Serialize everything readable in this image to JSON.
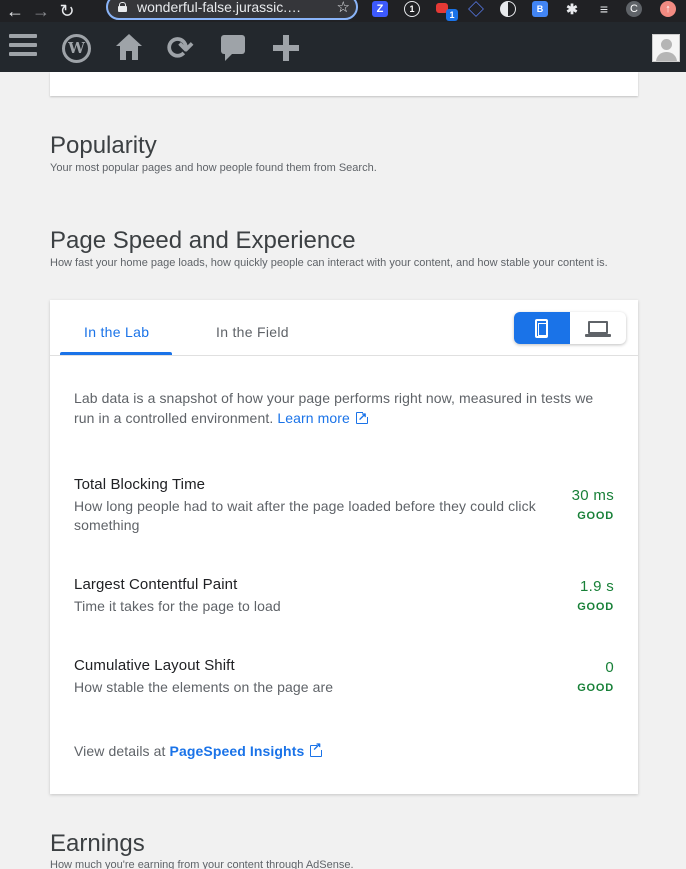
{
  "browser": {
    "url": "wonderful-false.jurassic.…",
    "extension_badge": "1",
    "profile_initial": "C"
  },
  "admin_bar": {
    "icons": [
      "menu-icon",
      "wordpress-logo",
      "home-icon",
      "refresh-icon",
      "comment-icon",
      "plus-icon",
      "avatar"
    ]
  },
  "popularity": {
    "title": "Popularity",
    "description": "Your most popular pages and how people found them from Search."
  },
  "page_speed": {
    "title": "Page Speed and Experience",
    "description": "How fast your home page loads, how quickly people can interact with your content, and how stable your content is.",
    "tabs": [
      {
        "label": "In the Lab",
        "active": true
      },
      {
        "label": "In the Field",
        "active": false
      }
    ],
    "device_toggle": {
      "selected": "mobile",
      "options": [
        "mobile",
        "desktop"
      ]
    },
    "intro": "Lab data is a snapshot of how your page performs right now, measured in tests we run in a controlled environment.",
    "learn_more": "Learn more",
    "metrics": [
      {
        "name": "Total Blocking Time",
        "description": "How long people had to wait after the page loaded before they could click something",
        "value": "30 ms",
        "status": "GOOD"
      },
      {
        "name": "Largest Contentful Paint",
        "description": "Time it takes for the page to load",
        "value": "1.9 s",
        "status": "GOOD"
      },
      {
        "name": "Cumulative Layout Shift",
        "description": "How stable the elements on the page are",
        "value": "0",
        "status": "GOOD"
      }
    ],
    "details_prefix": "View details at",
    "details_link": "PageSpeed Insights"
  },
  "earnings": {
    "title": "Earnings",
    "description": "How much you're earning from your content through AdSense."
  },
  "colors": {
    "accent": "#1a73e8",
    "good": "#188038",
    "admin_bar": "#23282d"
  }
}
